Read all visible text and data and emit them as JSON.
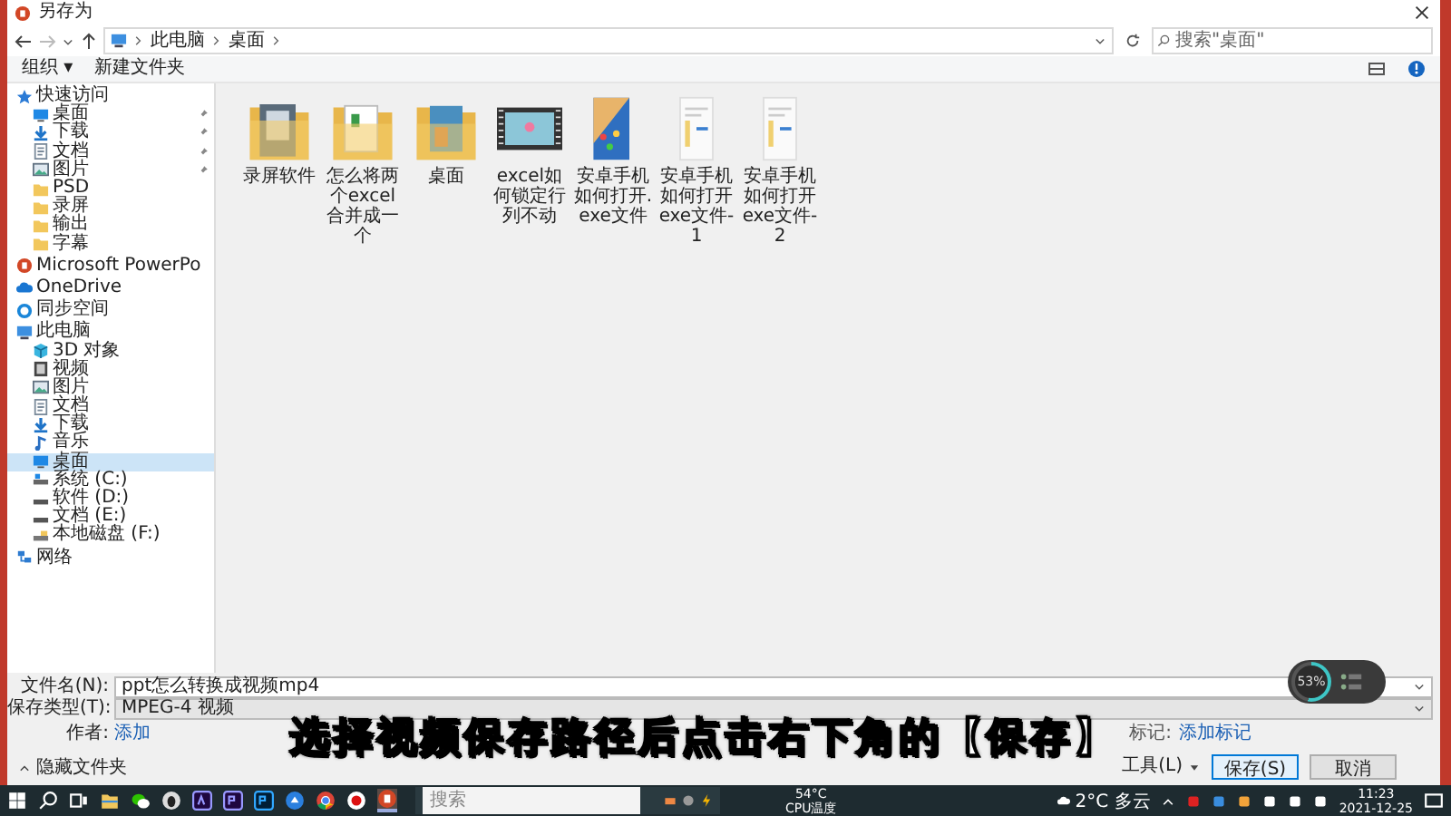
{
  "window": {
    "title": "另存为"
  },
  "address_bar": {
    "path": [
      "此电脑",
      "桌面"
    ],
    "search": {
      "placeholder": "搜索\"桌面\""
    }
  },
  "toolbar": {
    "organize": "组织 ▾",
    "new_folder": "新建文件夹"
  },
  "sidebar": {
    "items": [
      {
        "label": "快速访问",
        "kind": "star",
        "selected": false,
        "children": [
          {
            "label": "桌面",
            "kind": "desktop",
            "pinned": true,
            "selected": false
          },
          {
            "label": "下载",
            "kind": "download",
            "pinned": true,
            "selected": false
          },
          {
            "label": "文档",
            "kind": "document",
            "pinned": true,
            "selected": false
          },
          {
            "label": "图片",
            "kind": "picture",
            "pinned": true,
            "selected": false
          },
          {
            "label": "PSD",
            "kind": "folder",
            "pinned": false,
            "selected": false
          },
          {
            "label": "录屏",
            "kind": "folder",
            "pinned": false,
            "selected": false
          },
          {
            "label": "输出",
            "kind": "folder",
            "pinned": false,
            "selected": false
          },
          {
            "label": "字幕",
            "kind": "folder",
            "pinned": false,
            "selected": false
          }
        ]
      },
      {
        "label": "Microsoft PowerPo",
        "kind": "ppt",
        "selected": false
      },
      {
        "label": "OneDrive",
        "kind": "cloud",
        "selected": false
      },
      {
        "label": "同步空间",
        "kind": "sync",
        "selected": false
      },
      {
        "label": "此电脑",
        "kind": "pc",
        "selected": false,
        "children": [
          {
            "label": "3D 对象",
            "kind": "cube",
            "selected": false
          },
          {
            "label": "视频",
            "kind": "video",
            "selected": false
          },
          {
            "label": "图片",
            "kind": "picture",
            "selected": false
          },
          {
            "label": "文档",
            "kind": "document",
            "selected": false
          },
          {
            "label": "下载",
            "kind": "download",
            "selected": false
          },
          {
            "label": "音乐",
            "kind": "music",
            "selected": false
          },
          {
            "label": "桌面",
            "kind": "desktop",
            "selected": true
          },
          {
            "label": "系统 (C:)",
            "kind": "drive-c",
            "selected": false
          },
          {
            "label": "软件 (D:)",
            "kind": "drive",
            "selected": false
          },
          {
            "label": "文档 (E:)",
            "kind": "drive",
            "selected": false
          },
          {
            "label": "本地磁盘 (F:)",
            "kind": "drive-f",
            "selected": false
          }
        ]
      },
      {
        "label": "网络",
        "kind": "network",
        "selected": false
      }
    ]
  },
  "files": [
    {
      "name": "录屏软件",
      "kind": "folder-photo"
    },
    {
      "name": "怎么将两个excel合并成一个",
      "kind": "folder-doc"
    },
    {
      "name": "桌面",
      "kind": "folder-picture"
    },
    {
      "name": "excel如何锁定行列不动",
      "kind": "video"
    },
    {
      "name": "安卓手机如何打开.exe文件",
      "kind": "phone-image"
    },
    {
      "name": "安卓手机如何打开exe文件-1",
      "kind": "screen-image"
    },
    {
      "name": "安卓手机如何打开exe文件-2",
      "kind": "screen-image"
    }
  ],
  "form": {
    "filename": {
      "label": "文件名(N):",
      "value": "ppt怎么转换成视频mp4"
    },
    "type": {
      "label": "保存类型(T):",
      "value": "MPEG-4 视频"
    },
    "authors": {
      "label": "作者:",
      "value": "添加"
    },
    "tags": {
      "label": "标记:",
      "value": "添加标记"
    },
    "hide_folders": "隐藏文件夹",
    "tools": "工具(L)",
    "save": "保存(S)",
    "cancel": "取消"
  },
  "monitor_widget": {
    "reading": "53%"
  },
  "subtitle": "选择视频保存路径后点击右下角的【保存】",
  "taskbar": {
    "apps": [
      {
        "kind": "explorer"
      },
      {
        "kind": "wechat"
      },
      {
        "kind": "penguin"
      },
      {
        "kind": "ae"
      },
      {
        "kind": "pr"
      },
      {
        "kind": "ps"
      },
      {
        "kind": "blue"
      },
      {
        "kind": "chrome"
      },
      {
        "kind": "record"
      },
      {
        "kind": "ppt"
      }
    ],
    "search": {
      "placeholder": "搜索"
    },
    "cpu": {
      "temp": "54°C",
      "label": "CPU温度"
    },
    "weather": "2°C 多云",
    "time": "11:23",
    "date": "2021-12-25"
  }
}
